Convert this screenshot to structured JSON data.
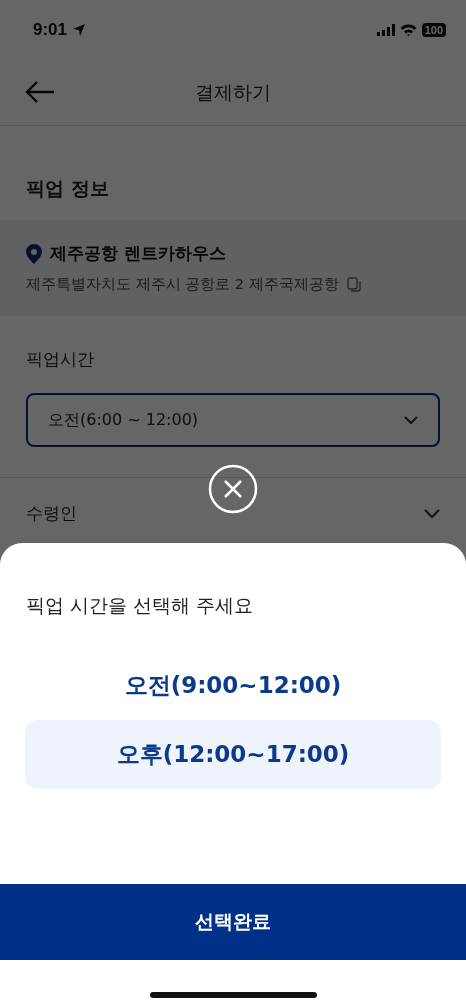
{
  "status_bar": {
    "time": "9:01",
    "battery": "100"
  },
  "header": {
    "title": "결제하기"
  },
  "pickup_info": {
    "heading": "픽업 정보",
    "place": "제주공항 렌트카하우스",
    "address": "제주특별자치도 제주시 공항로 2 제주국제공항"
  },
  "pickup_time": {
    "label": "픽업시간",
    "value": "오전(6:00 ~ 12:00)"
  },
  "recipient": {
    "label": "수령인"
  },
  "sheet": {
    "prompt": "픽업 시간을 선택해 주세요",
    "options": [
      {
        "label": "오전(9:00~12:00)",
        "selected": false
      },
      {
        "label": "오후(12:00~17:00)",
        "selected": true
      }
    ],
    "confirm": "선택완료"
  }
}
